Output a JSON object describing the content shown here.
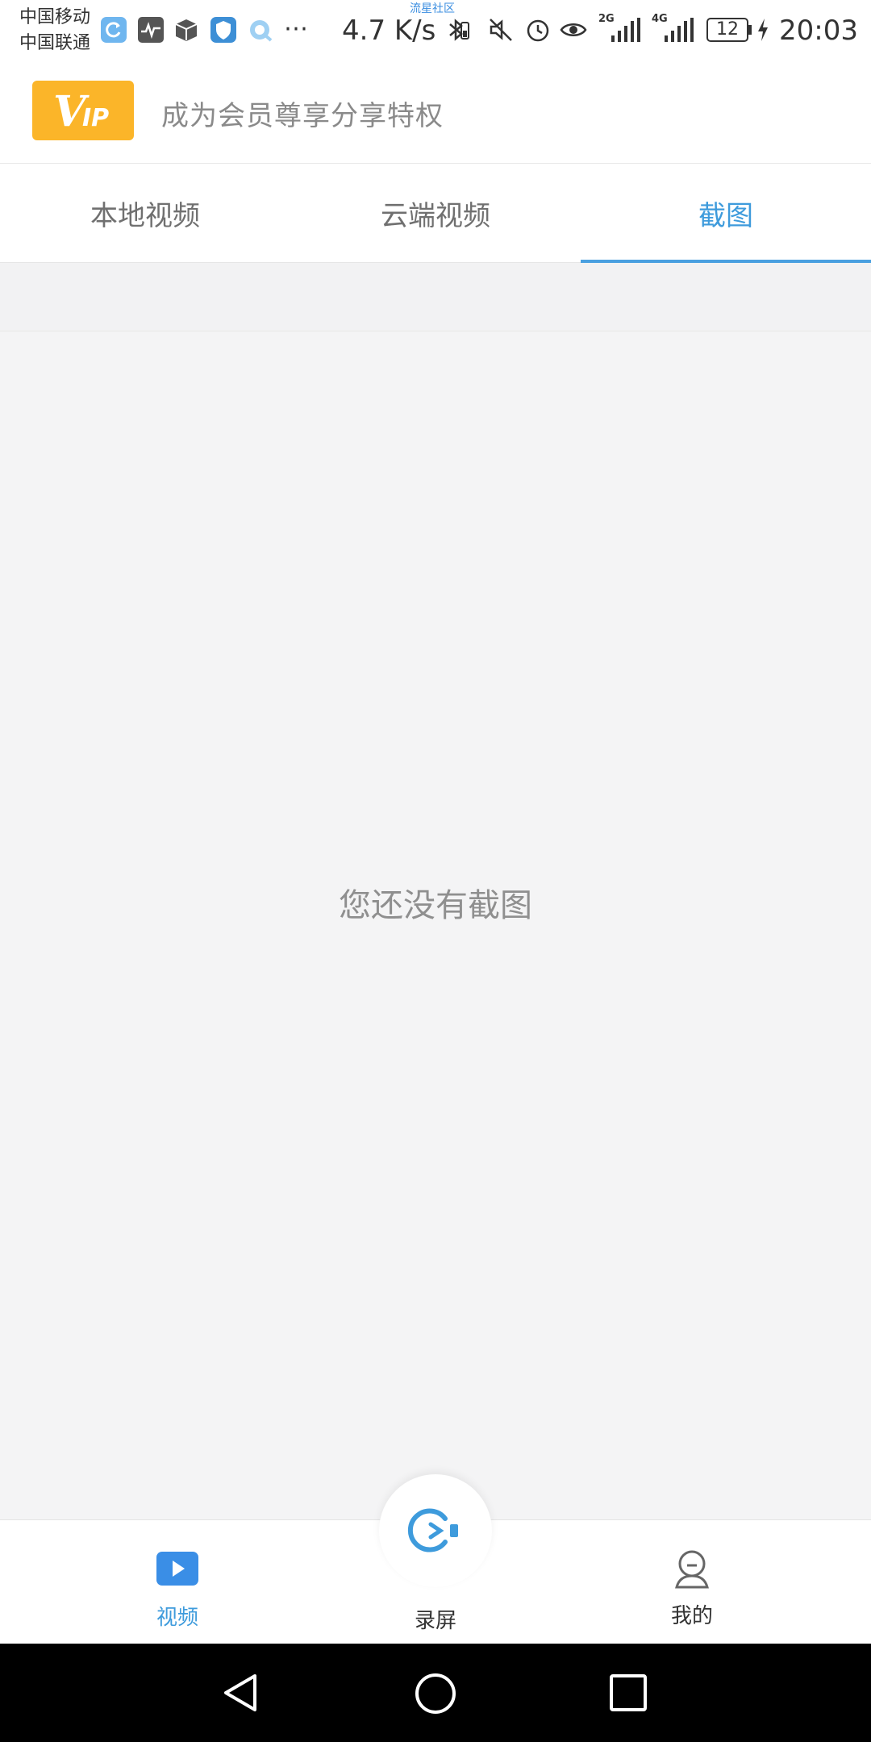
{
  "status_bar": {
    "carrier_1": "中国移动",
    "carrier_2": "中国联通",
    "watermark": "流星社区",
    "net_speed": "4.7 K/s",
    "signal_1_label": "2G",
    "signal_2_label": "4G",
    "battery": "12",
    "time": "20:03"
  },
  "vip_banner": {
    "badge": "VIP",
    "text": "成为会员尊享分享特权"
  },
  "tabs": [
    {
      "label": "本地视频",
      "active": false
    },
    {
      "label": "云端视频",
      "active": false
    },
    {
      "label": "截图",
      "active": true
    }
  ],
  "empty_state": {
    "message": "您还没有截图"
  },
  "bottom_nav": {
    "videos": "视频",
    "record": "录屏",
    "mine": "我的"
  },
  "colors": {
    "accent": "#3e9bdc",
    "vip": "#fbb529",
    "background": "#f4f4f5"
  }
}
